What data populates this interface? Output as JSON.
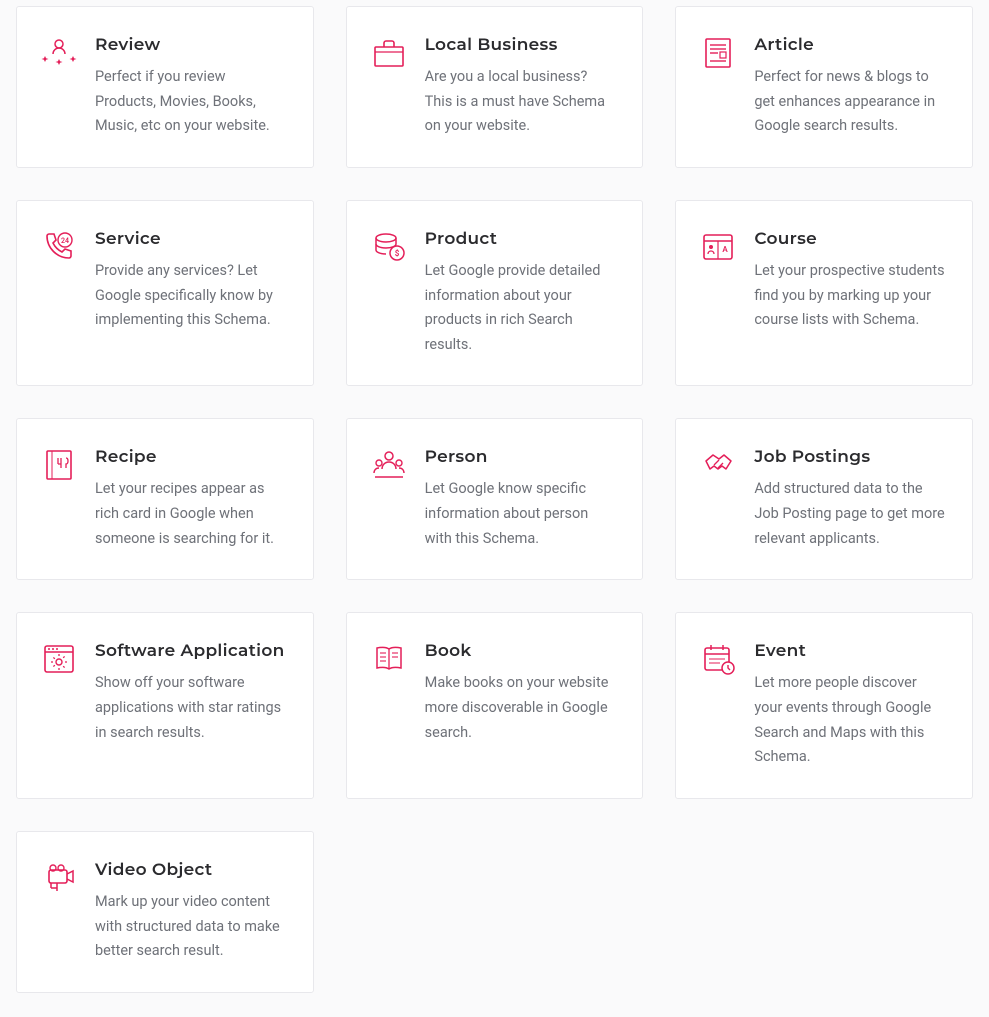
{
  "cards": [
    {
      "icon": "review-icon",
      "title": "Review",
      "desc": "Perfect if you review Products, Movies, Books, Music, etc on your website."
    },
    {
      "icon": "briefcase-icon",
      "title": "Local Business",
      "desc": "Are you a local business? This is a must have Schema on your website."
    },
    {
      "icon": "article-icon",
      "title": "Article",
      "desc": "Perfect for news & blogs to get enhances appearance in Google search results."
    },
    {
      "icon": "phone-24-icon",
      "title": "Service",
      "desc": "Provide any services? Let Google specifically know by implementing this Schema."
    },
    {
      "icon": "coins-icon",
      "title": "Product",
      "desc": "Let Google provide detailed information about your products in rich Search results."
    },
    {
      "icon": "course-icon",
      "title": "Course",
      "desc": "Let your prospective students find you by marking up your course lists with Schema."
    },
    {
      "icon": "recipe-icon",
      "title": "Recipe",
      "desc": "Let your recipes appear as rich card in Google when someone is searching for it."
    },
    {
      "icon": "people-icon",
      "title": "Person",
      "desc": "Let Google know specific information about person with this Schema."
    },
    {
      "icon": "handshake-icon",
      "title": "Job Postings",
      "desc": "Add structured data to the Job Posting page to get more relevant applicants."
    },
    {
      "icon": "gear-window-icon",
      "title": "Software Application",
      "desc": "Show off your software applications with star ratings in search results."
    },
    {
      "icon": "book-icon",
      "title": "Book",
      "desc": "Make books on your website more discoverable in Google search."
    },
    {
      "icon": "calendar-icon",
      "title": "Event",
      "desc": "Let more people discover your events through Google Search and Maps with this Schema."
    },
    {
      "icon": "video-icon",
      "title": "Video Object",
      "desc": "Mark up your video content with structured data to make better search result."
    }
  ],
  "colors": {
    "accent": "#e41f59"
  }
}
